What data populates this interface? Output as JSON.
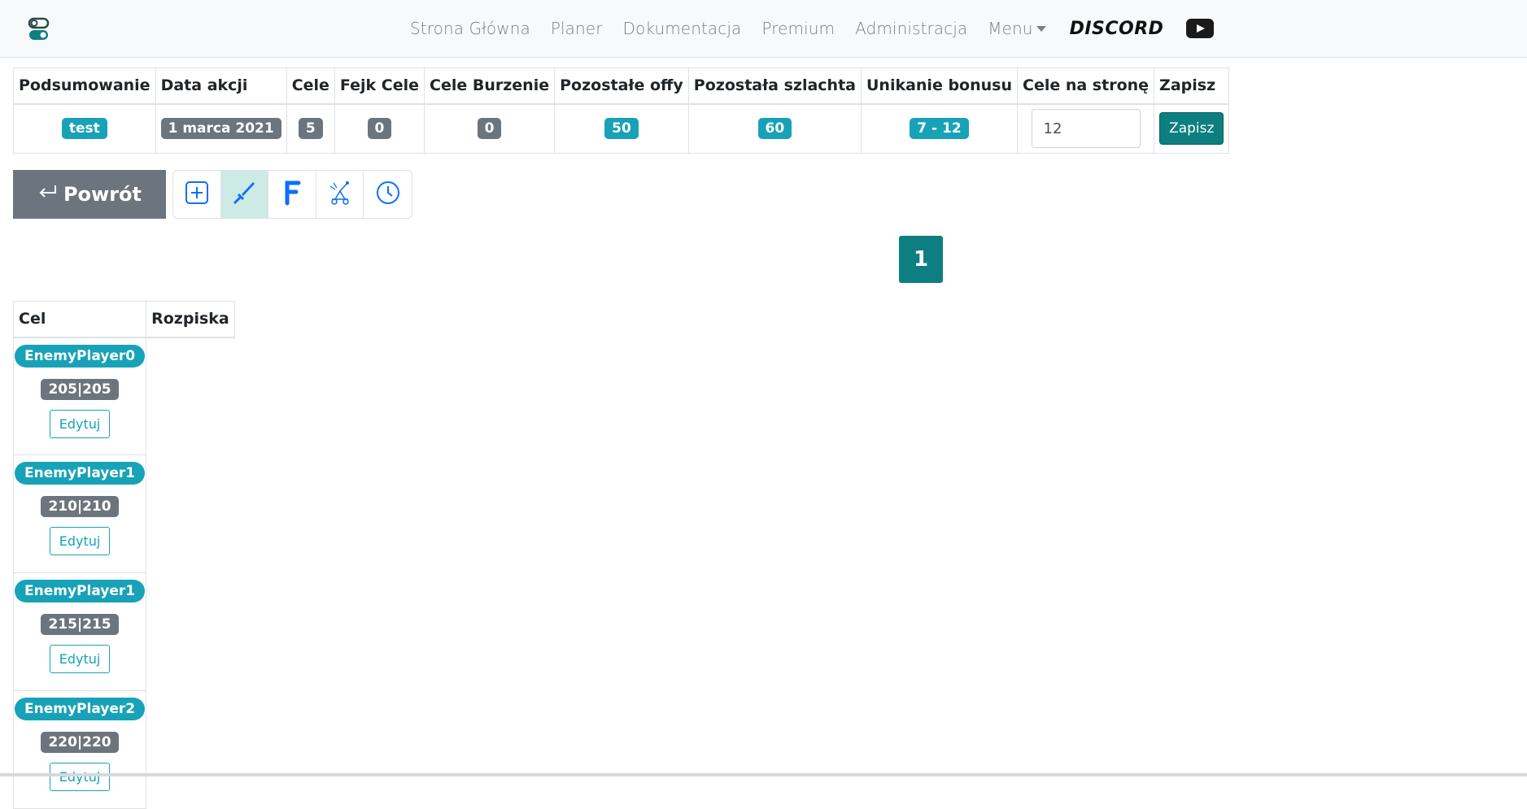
{
  "navbar": {
    "logo_icon": "toggle-switches-icon",
    "links": [
      "Strona Główna",
      "Planer",
      "Dokumentacja",
      "Premium",
      "Administracja"
    ],
    "menu_label": "Menu",
    "discord_label": "DISCORD",
    "youtube_icon": "youtube-icon"
  },
  "summary": {
    "headers": [
      "Podsumowanie",
      "Data akcji",
      "Cele",
      "Fejk Cele",
      "Cele Burzenie",
      "Pozostałe offy",
      "Pozostała szlachta",
      "Unikanie bonusu",
      "Cele na stronę",
      "Zapisz"
    ],
    "values": {
      "podsumowanie": "test",
      "data_akcji": "1 marca 2021",
      "cele": "5",
      "fejk_cele": "0",
      "cele_burzenie": "0",
      "pozostale_offy": "50",
      "pozostala_szlachta": "60",
      "unikanie_bonusu": "7 - 12",
      "cele_na_strone": "12"
    },
    "save_label": "Zapisz"
  },
  "back_button": {
    "label": "Powrót",
    "icon": "return-arrow-icon"
  },
  "toolbar": {
    "tools": [
      {
        "icon": "plus-square-icon",
        "active": false
      },
      {
        "icon": "sword-icon",
        "active": true
      },
      {
        "icon": "letter-f-icon",
        "active": false
      },
      {
        "icon": "catapult-icon",
        "active": false
      },
      {
        "icon": "clock-icon",
        "active": false
      }
    ]
  },
  "pagination": {
    "current_page": "1"
  },
  "targets": {
    "headers": [
      "Cel",
      "Rozpiska"
    ],
    "edit_label": "Edytuj",
    "rows": [
      {
        "player": "EnemyPlayer0",
        "coords": "205|205"
      },
      {
        "player": "EnemyPlayer1",
        "coords": "210|210"
      },
      {
        "player": "EnemyPlayer1",
        "coords": "215|215"
      },
      {
        "player": "EnemyPlayer2",
        "coords": "220|220"
      }
    ]
  },
  "colors": {
    "info": "#17a2b8",
    "secondary": "#6c757d",
    "primary_teal": "#0d7f80",
    "tool_active_bg": "#cdeae4",
    "icon_blue": "#0d6efd"
  }
}
